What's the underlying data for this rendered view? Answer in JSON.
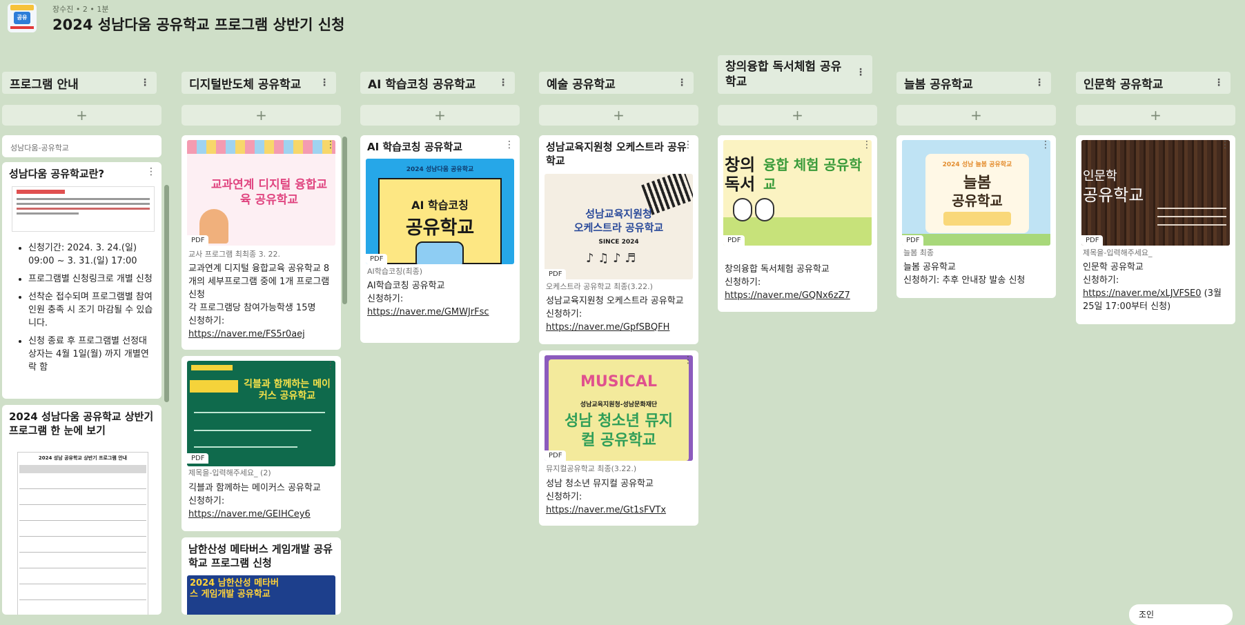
{
  "header": {
    "meta": "장수진 • 2 • 1분",
    "title": "2024 성남다움 공유학교 프로그램 상반기 신청"
  },
  "columns": [
    {
      "title": "프로그램 안내"
    },
    {
      "title": "디지털반도체 공유학교"
    },
    {
      "title": "AI 학습코칭 공유학교"
    },
    {
      "title": "예술 공유학교"
    },
    {
      "title": "창의융합 독서체험 공유학교"
    },
    {
      "title": "늘봄 공유학교"
    },
    {
      "title": "인문학 공유학교"
    }
  ],
  "add_label": "+",
  "pdf_label": "PDF",
  "cards": {
    "c0_top": {
      "label": "성남다움-공유학교"
    },
    "c0_a": {
      "title": "성남다움 공유학교란?",
      "bullets": [
        "신청기간: 2024. 3. 24.(일) 09:00 ~ 3. 31.(일) 17:00",
        "프로그램별 신청링크로 개별 신청",
        "선착순 접수되며 프로그램별 참여 인원 충족 시 조기 마감될 수 있습니다.",
        "신청 종료 후 프로그램별 선정대상자는 4월 1일(월) 까지 개별연락 함"
      ]
    },
    "c0_b": {
      "title": "2024 성남다움 공유학교 상반기 프로그램 한 눈에 보기",
      "table_title": "2024 성남 공유학교 상반기 프로그램 안내"
    },
    "c1_a": {
      "thumb": "교과연계 디지털 융합교육 공유학교",
      "sub": "교사 프로그램 최최종 3. 22.",
      "lines": [
        "교과연계 디지털 융합교육 공유학교 8개의 세부프로그램 중에 1개 프로그램 신청",
        "각 프로그램당 참여가능학생 15명",
        "신청하기:"
      ],
      "link": "https://naver.me/FS5r0aej"
    },
    "c1_b": {
      "thumb": "긱블과 함께하는 메이커스 공유학교",
      "sub": "제목을-입력해주세요_ (2)",
      "lines": [
        "긱블과 함께하는 메이커스 공유학교",
        "신청하기:"
      ],
      "link": "https://naver.me/GEIHCey6"
    },
    "c1_c": {
      "title": "남한산성 메타버스 게임개발 공유학교 프로그램 신청",
      "thumb": "2024 남한산성 메타버스 게임개발 공유학교"
    },
    "c2_a": {
      "title": "AI 학습코칭 공유학교",
      "thumb_top": "2024 성남다움 공유학교",
      "thumb1": "AI 학습코칭",
      "thumb2": "공유학교",
      "sub": "AI학습코칭(최종)",
      "lines": [
        "AI학습코칭 공유학교",
        "신청하기:"
      ],
      "link": "https://naver.me/GMWJrFsc"
    },
    "c3_a": {
      "title": "성남교육지원청 오케스트라 공유학교",
      "thumb1": "성남교육지원청",
      "thumb2": "오케스트라 공유학교",
      "thumb3": "SINCE 2024",
      "sub": "오케스트라 공유학교 최종(3.22.)",
      "lines": [
        "성남교육지원청 오케스트라 공유학교",
        "신청하기:"
      ],
      "link": "https://naver.me/GpfSBQFH"
    },
    "c3_b": {
      "thumb1": "MUSICAL",
      "thumb2": "성남교육지원청-성남문화재단",
      "thumb3": "성남 청소년 뮤지컬 공유학교",
      "sub": "뮤지컬공유학교 최종(3.22.)",
      "lines": [
        "성남 청소년 뮤지컬 공유학교",
        "신청하기:"
      ],
      "link": "https://naver.me/Gt1sFVTx"
    },
    "c4_a": {
      "thumb1": "창의",
      "thumb2": "독서",
      "thumb3": "융합 체험 공유학교",
      "lines": [
        "창의융합 독서체험 공유학교",
        "신청하기:"
      ],
      "link": "https://naver.me/GQNx6zZ7"
    },
    "c5_a": {
      "thumb1": "2024 성남 늘봄 공유학교",
      "thumb2": "늘봄",
      "thumb3": "공유학교",
      "sub": "늘봄 최종",
      "lines": [
        "늘봄 공유학교",
        "신청하기: 추후 안내장 발송 신청"
      ]
    },
    "c6_a": {
      "thumb1": "인문학",
      "thumb2": "공유학교",
      "sub": "제목을-입력해주세요_",
      "lines": [
        "인문학 공유학교",
        "신청하기:"
      ],
      "link": "https://naver.me/xLJVFSE0",
      "link_suffix": " (3월 25일 17:00부터 신청)"
    }
  },
  "footer": {
    "chip": "조인"
  }
}
